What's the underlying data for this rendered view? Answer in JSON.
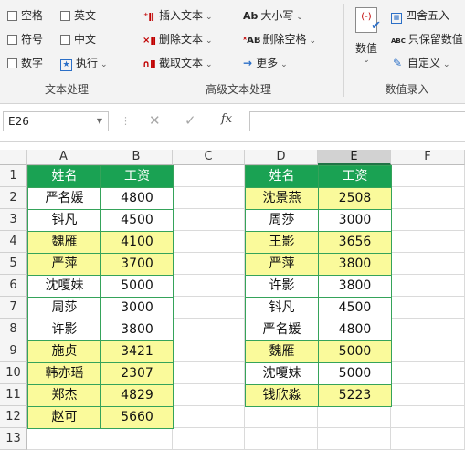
{
  "ribbon": {
    "text_group": {
      "label": "文本处理",
      "checkboxes": [
        "空格",
        "英文",
        "符号",
        "中文",
        "数字"
      ],
      "exec_label": "执行"
    },
    "adv_group": {
      "label": "高级文本处理",
      "insert": "插入文本",
      "delete": "删除文本",
      "extract": "截取文本",
      "case": "大小写",
      "case_icon": "Ab",
      "del_space": "删除空格",
      "del_space_icon": "AB",
      "more": "更多"
    },
    "num_group": {
      "label": "数值录入",
      "value_btn": "数值",
      "round": "四舍五入",
      "keep": "只保留数值",
      "keep_icon": "ABC",
      "custom": "自定义"
    }
  },
  "formula_bar": {
    "name_box": "E26",
    "fx": "fx",
    "formula": ""
  },
  "columns": [
    "A",
    "B",
    "C",
    "D",
    "E",
    "F"
  ],
  "selected_column": "E",
  "rows": [
    "1",
    "2",
    "3",
    "4",
    "5",
    "6",
    "7",
    "8",
    "9",
    "10",
    "11",
    "12",
    "13"
  ],
  "table1": {
    "headers": [
      "姓名",
      "工资"
    ],
    "rows": [
      [
        "严名媛",
        "4800",
        false
      ],
      [
        "钭凡",
        "4500",
        false
      ],
      [
        "魏雁",
        "4100",
        true
      ],
      [
        "严萍",
        "3700",
        true
      ],
      [
        "沈嗄妹",
        "5000",
        false
      ],
      [
        "周莎",
        "3000",
        false
      ],
      [
        "许影",
        "3800",
        false
      ],
      [
        "施贞",
        "3421",
        true
      ],
      [
        "韩亦瑶",
        "2307",
        true
      ],
      [
        "郑杰",
        "4829",
        true
      ],
      [
        "赵可",
        "5660",
        true
      ]
    ]
  },
  "table2": {
    "headers": [
      "姓名",
      "工资"
    ],
    "rows": [
      [
        "沈景燕",
        "2508",
        true
      ],
      [
        "周莎",
        "3000",
        false
      ],
      [
        "王影",
        "3656",
        true
      ],
      [
        "严萍",
        "3800",
        true
      ],
      [
        "许影",
        "3800",
        false
      ],
      [
        "钭凡",
        "4500",
        false
      ],
      [
        "严名媛",
        "4800",
        false
      ],
      [
        "魏雁",
        "5000",
        true
      ],
      [
        "沈嗄妹",
        "5000",
        false
      ],
      [
        "钱欣淼",
        "5223",
        true
      ]
    ]
  },
  "colors": {
    "header_green": "#1aa253",
    "highlight_yellow": "#fafa9b",
    "table_border": "#35a35a"
  }
}
